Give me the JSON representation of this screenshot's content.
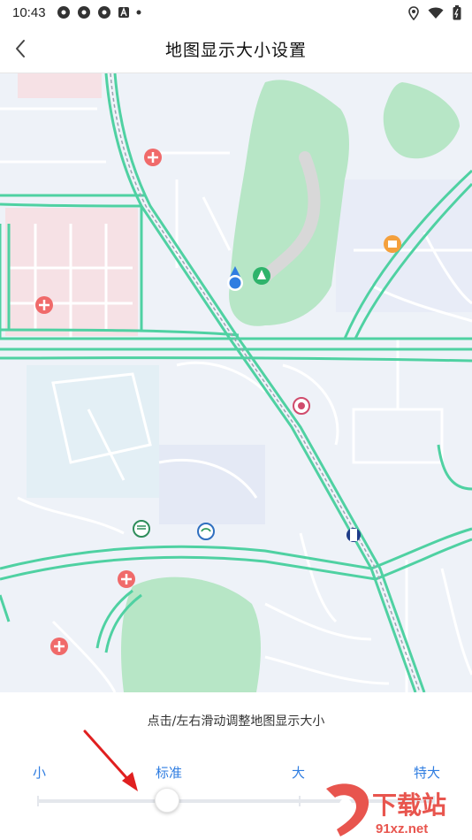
{
  "status_bar": {
    "time": "10:43",
    "left_icons": [
      "app-icon",
      "app-icon",
      "app-icon",
      "a-icon",
      "dot"
    ],
    "right_icons": [
      "location-icon",
      "wifi-icon",
      "battery-icon"
    ]
  },
  "nav": {
    "title": "地图显示大小设置",
    "back_icon": "chevron-left-icon"
  },
  "map": {
    "colors": {
      "road": "#4fd1a2",
      "park": "#b7e6c6",
      "hospital_zone": "#f6e1e5",
      "background": "#eef2f8"
    },
    "pois": [
      "hospital-icon",
      "park-icon",
      "restaurant-icon",
      "bank-icon",
      "metro-icon",
      "location-dot-icon"
    ]
  },
  "panel": {
    "hint": "点击/左右滑动调整地图显示大小",
    "sizes": [
      "小",
      "标准",
      "大",
      "特大"
    ],
    "selected": "标准",
    "selected_index": 1,
    "accent": "#2f7de1"
  },
  "watermark": {
    "main": "下载站",
    "url": "91xz.net"
  }
}
